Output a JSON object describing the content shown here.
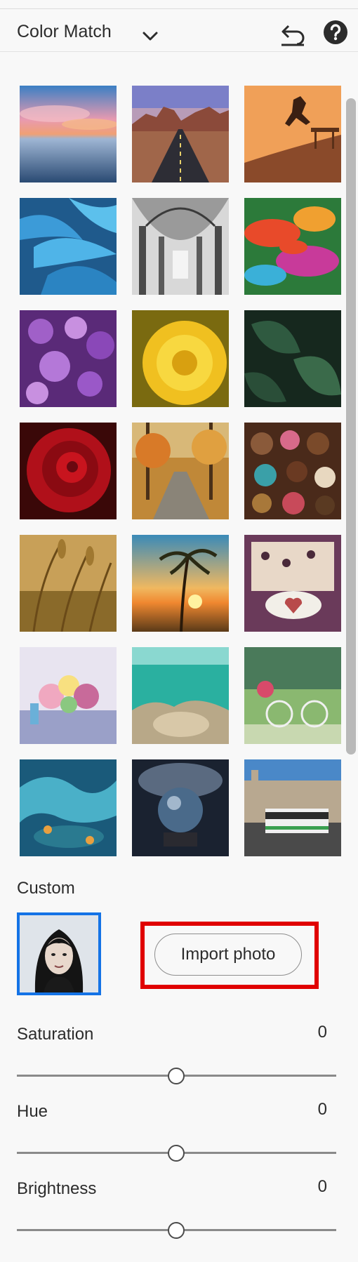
{
  "header": {
    "title": "Color Match",
    "icons": {
      "dropdown": "chevron-down-icon",
      "reset": "undo-icon",
      "help": "help-icon"
    }
  },
  "presets": [
    {
      "name": "sunset-sea"
    },
    {
      "name": "desert-road"
    },
    {
      "name": "skateboarder"
    },
    {
      "name": "blue-feathers"
    },
    {
      "name": "cathedral-arches"
    },
    {
      "name": "paint-splash"
    },
    {
      "name": "purple-lilac"
    },
    {
      "name": "yellow-dahlia"
    },
    {
      "name": "green-leaves"
    },
    {
      "name": "red-rose"
    },
    {
      "name": "autumn-path"
    },
    {
      "name": "chocolate-sweets"
    },
    {
      "name": "wheat-field"
    },
    {
      "name": "palm-beach-sunset"
    },
    {
      "name": "coffee-heart"
    },
    {
      "name": "flower-table"
    },
    {
      "name": "underwater-reef"
    },
    {
      "name": "bicycle-street"
    },
    {
      "name": "fantasy-ocean"
    },
    {
      "name": "crystal-ball"
    },
    {
      "name": "city-bus"
    }
  ],
  "custom": {
    "label": "Custom",
    "import_label": "Import photo"
  },
  "sliders": [
    {
      "label": "Saturation",
      "value": "0"
    },
    {
      "label": "Hue",
      "value": "0"
    },
    {
      "label": "Brightness",
      "value": "0"
    }
  ],
  "colors": {
    "accent": "#1473e6",
    "highlight": "#e00000"
  }
}
